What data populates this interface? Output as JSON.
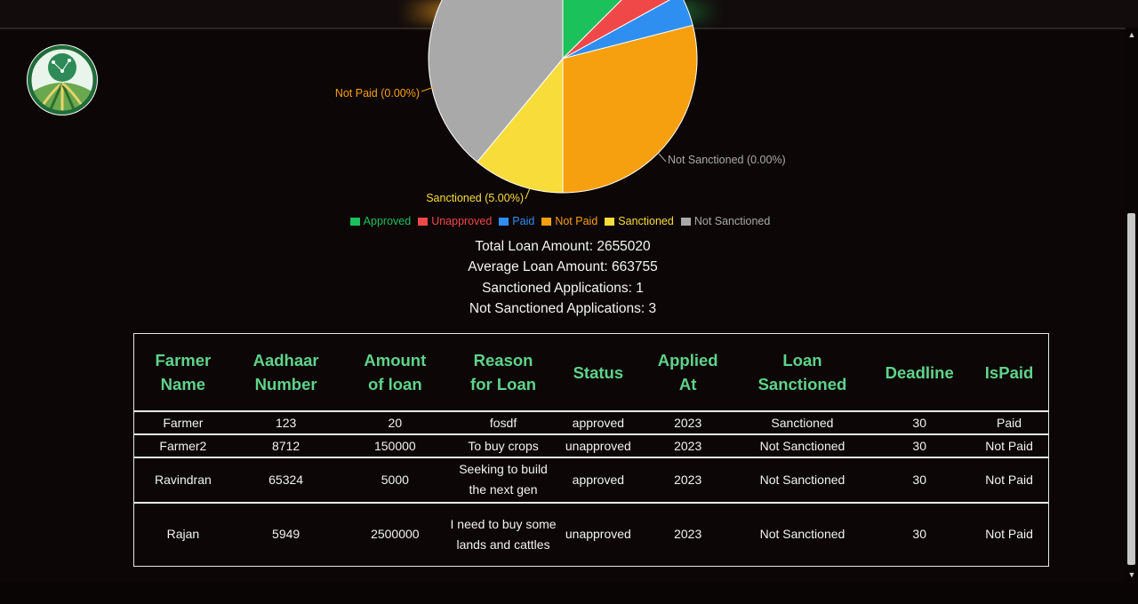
{
  "chart_data": {
    "type": "pie",
    "slices": [
      {
        "name": "Approved",
        "value": 0.125,
        "color": "#1bc15a"
      },
      {
        "name": "Unapproved",
        "value": 0.045,
        "color": "#f04848"
      },
      {
        "name": "Paid",
        "value": 0.04,
        "color": "#2f8ff0"
      },
      {
        "name": "Not Paid",
        "value": 0.29,
        "color": "#f7a00f"
      },
      {
        "name": "Sanctioned",
        "value": 0.11,
        "color": "#f8dd3a"
      },
      {
        "name": "Not Sanctioned",
        "value": 0.39,
        "color": "#a9a9a9"
      }
    ],
    "labels": {
      "not_paid": "Not Paid (0.00%)",
      "not_sanctioned": "Not Sanctioned (0.00%)",
      "sanctioned": "Sanctioned (5.00%)"
    },
    "legend": [
      "Approved",
      "Unapproved",
      "Paid",
      "Not Paid",
      "Sanctioned",
      "Not Sanctioned"
    ],
    "legend_placement": "bottom"
  },
  "stats": {
    "total": "Total Loan Amount: 2655020",
    "average": "Average Loan Amount: 663755",
    "sanctioned": "Sanctioned Applications: 1",
    "not_sanctioned": "Not Sanctioned Applications: 3"
  },
  "table": {
    "headers": [
      [
        "Farmer",
        "Name"
      ],
      [
        "Aadhaar",
        "Number"
      ],
      [
        "Amount",
        "of loan"
      ],
      [
        "Reason",
        "for Loan"
      ],
      [
        "Status"
      ],
      [
        "Applied",
        "At"
      ],
      [
        "Loan",
        "Sanctioned"
      ],
      [
        "Deadline"
      ],
      [
        "IsPaid"
      ]
    ],
    "rows": [
      [
        "Farmer",
        "123",
        "20",
        "fosdf",
        "approved",
        "2023",
        "Sanctioned",
        "30",
        "Paid"
      ],
      [
        "Farmer2",
        "8712",
        "150000",
        "To buy crops",
        "unapproved",
        "2023",
        "Not Sanctioned",
        "30",
        "Not Paid"
      ],
      [
        "Ravindran",
        "65324",
        "5000",
        "Seeking to build the next gen",
        "approved",
        "2023",
        "Not Sanctioned",
        "30",
        "Not Paid"
      ],
      [
        "Rajan",
        "5949",
        "2500000",
        "I need to buy some lands and cattles",
        "unapproved",
        "2023",
        "Not Sanctioned",
        "30",
        "Not Paid"
      ]
    ]
  },
  "logo": {
    "icon": "farm-field-logo-icon"
  },
  "colors": {
    "header_text": "#5fd38a",
    "background": "#0d0606"
  }
}
